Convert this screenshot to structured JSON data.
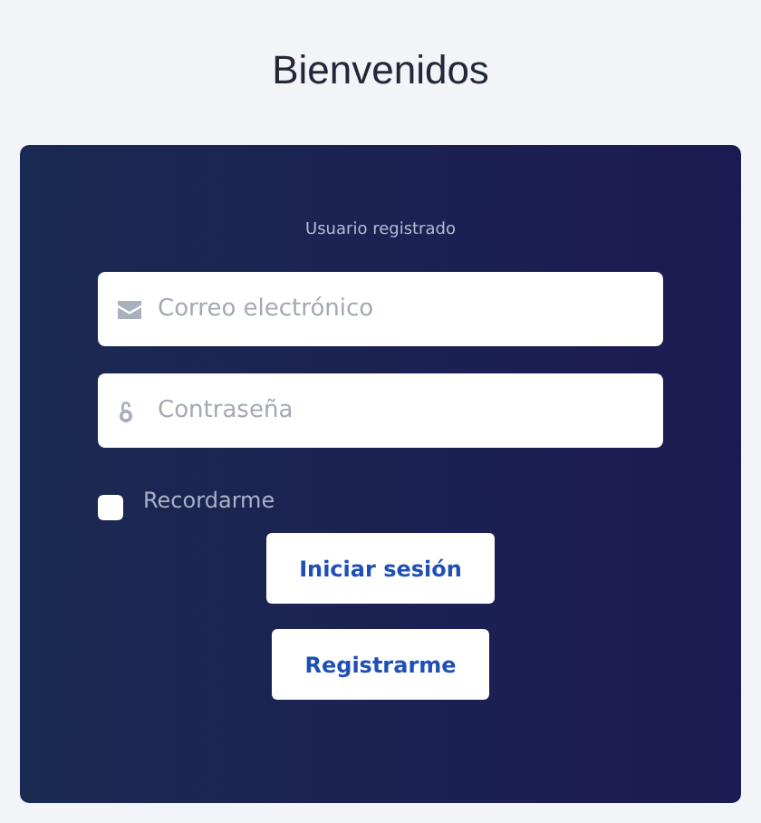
{
  "title": "Bienvenidos",
  "form": {
    "heading": "Usuario registrado",
    "fields": [
      {
        "kind": "email",
        "placeholder": "Correo electrónico"
      },
      {
        "kind": "password",
        "placeholder": "Contraseña"
      }
    ],
    "remember": {
      "label": "Recordarme",
      "checked": false
    },
    "buttons": [
      "Iniciar sesión",
      "Registrarme"
    ]
  }
}
